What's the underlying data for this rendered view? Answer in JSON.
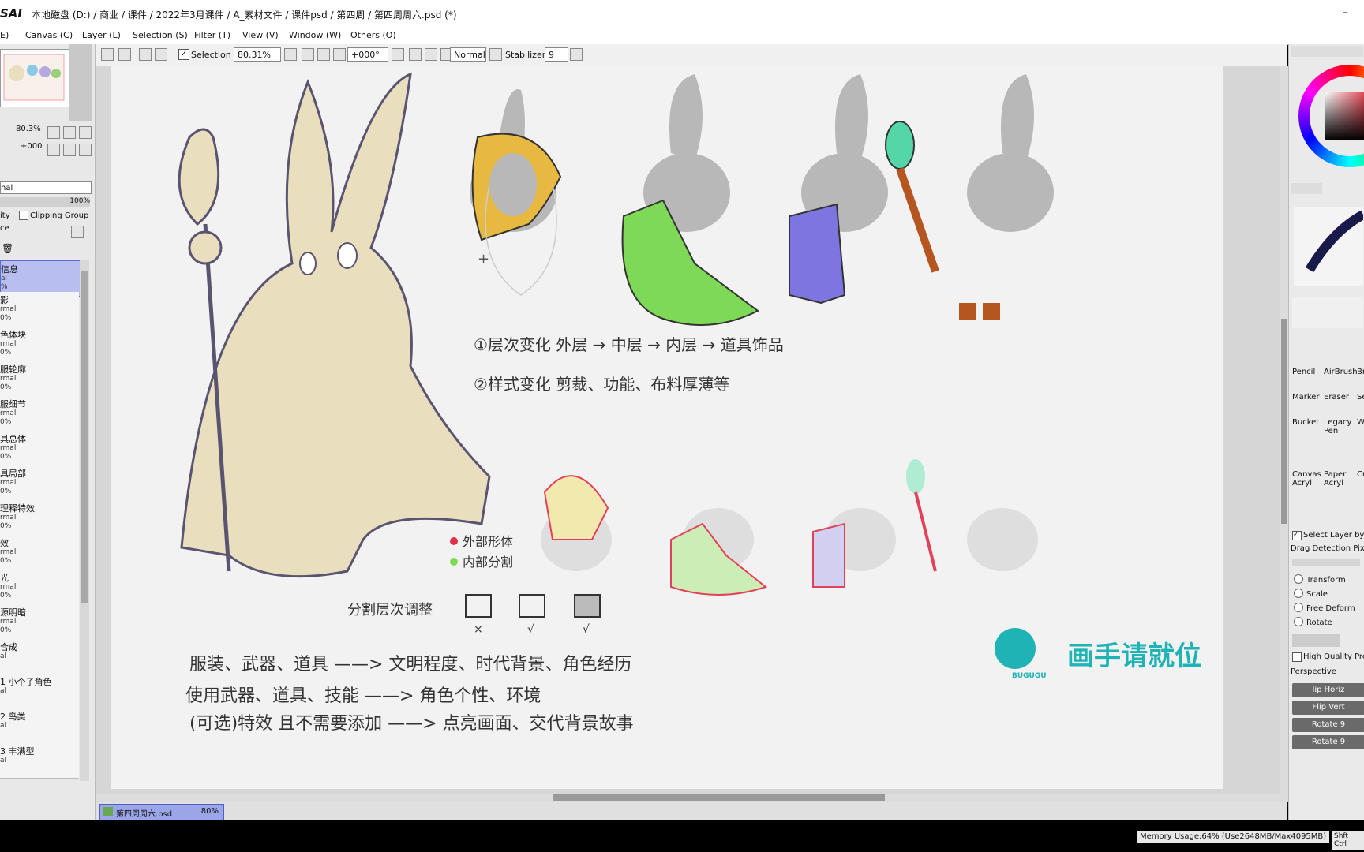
{
  "app": {
    "logo": "SAI",
    "path": "本地磁盘 (D:) / 商业 / 课件 / 2022年3月课件 / A_素材文件 / 课件psd / 第四周 / 第四周周六.psd (*)"
  },
  "menu": [
    "E)",
    "Canvas (C)",
    "Layer (L)",
    "Selection (S)",
    "Filter (T)",
    "View (V)",
    "Window (W)",
    "Others (O)"
  ],
  "toolbar": {
    "selection_label": "Selection",
    "zoom": "80.31%",
    "rotation": "+000°",
    "blend_mode": "Normal",
    "stabilizer_label": "Stabilizer",
    "stabilizer_value": "9"
  },
  "navigator": {
    "zoom": "80.3%",
    "rotation": "+000"
  },
  "layer_panel": {
    "blend_mode": "nal",
    "opacity": "100%",
    "opacity_label": "ity",
    "clipping_label": "Clipping Group",
    "preserve_label": "ce",
    "layers": [
      {
        "name": "信息",
        "mode": "al",
        "opacity": "%"
      },
      {
        "name": "影",
        "mode": "rmal",
        "opacity": "0%"
      },
      {
        "name": "色体块",
        "mode": "rmal",
        "opacity": "0%"
      },
      {
        "name": "服轮廓",
        "mode": "rmal",
        "opacity": "0%"
      },
      {
        "name": "服细节",
        "mode": "rmal",
        "opacity": "0%"
      },
      {
        "name": "具总体",
        "mode": "rmal",
        "opacity": "0%"
      },
      {
        "name": "具局部",
        "mode": "rmal",
        "opacity": "0%"
      },
      {
        "name": "理释特效",
        "mode": "rmal",
        "opacity": "0%"
      },
      {
        "name": "效",
        "mode": "rmal",
        "opacity": "0%"
      },
      {
        "name": "光",
        "mode": "rmal",
        "opacity": "0%"
      },
      {
        "name": "源明暗",
        "mode": "rmal",
        "opacity": "0%"
      },
      {
        "name": "合成",
        "mode": "al",
        "opacity": ""
      },
      {
        "name": "1 小个子角色",
        "mode": "al",
        "opacity": ""
      },
      {
        "name": "2 鸟类",
        "mode": "al",
        "opacity": ""
      },
      {
        "name": "3 丰满型",
        "mode": "al",
        "opacity": ""
      }
    ]
  },
  "tools": {
    "pencil": "Pencil",
    "airbrush": "AirBrush",
    "br": "Br",
    "marker": "Marker",
    "eraser": "Eraser",
    "se": "Se",
    "bucket": "Bucket",
    "legacy_pen": "Legacy Pen",
    "wa": "Wa",
    "canvas_acryl": "Canvas Acryl",
    "paper_acryl": "Paper Acryl",
    "cr": "Cr"
  },
  "transform": {
    "select_layer_label": "Select Layer by",
    "drag_detection_label": "Drag Detection Pix.",
    "options": [
      "Transform",
      "Scale",
      "Free Deform",
      "Rotate"
    ],
    "high_quality_label": "High Quality Pre",
    "perspective_label": "Perspective",
    "buttons": [
      "lip Horiz",
      "Flip Vert",
      "Rotate 9",
      "Rotate 9"
    ]
  },
  "canvas_notes": {
    "line1": "①层次变化   外层 → 中层 → 内层 → 道具饰品",
    "line2": "②样式变化   剪裁、功能、布料厚薄等",
    "legend_outer": "外部形体",
    "legend_inner": "内部分割",
    "split_label": "分割层次调整",
    "marks": [
      "×",
      "√",
      "√"
    ],
    "text_a": "服装、武器、道具  ——>  文明程度、时代背景、角色经历",
    "text_b": "使用武器、道具、技能  ——>  角色个性、环境",
    "text_c": "(可选)特效   且不需要添加  ——>  点亮画面、交代背景故事"
  },
  "watermark": {
    "text": "画手请就位",
    "brand": "BUGUGU"
  },
  "document_tab": {
    "name": "第四周周六.psd",
    "zoom": "80%"
  },
  "status": {
    "memory": "Memory Usage:64% (Use2648MB/Max4095MB)",
    "keys": "Shft Ctrl"
  },
  "colors": {
    "layer_selected": "#b8bff0",
    "tab_active": "#9aa6e8",
    "sketch_fill": "#e9dfbe",
    "green_cloak": "#7ed957",
    "purple_cloth": "#7d75e0",
    "hood_yellow": "#e8b940",
    "staff_brown": "#b5551f",
    "gem_teal": "#55d6a8",
    "outline_red": "#e0304a",
    "watermark_teal": "#1fb3b5"
  }
}
